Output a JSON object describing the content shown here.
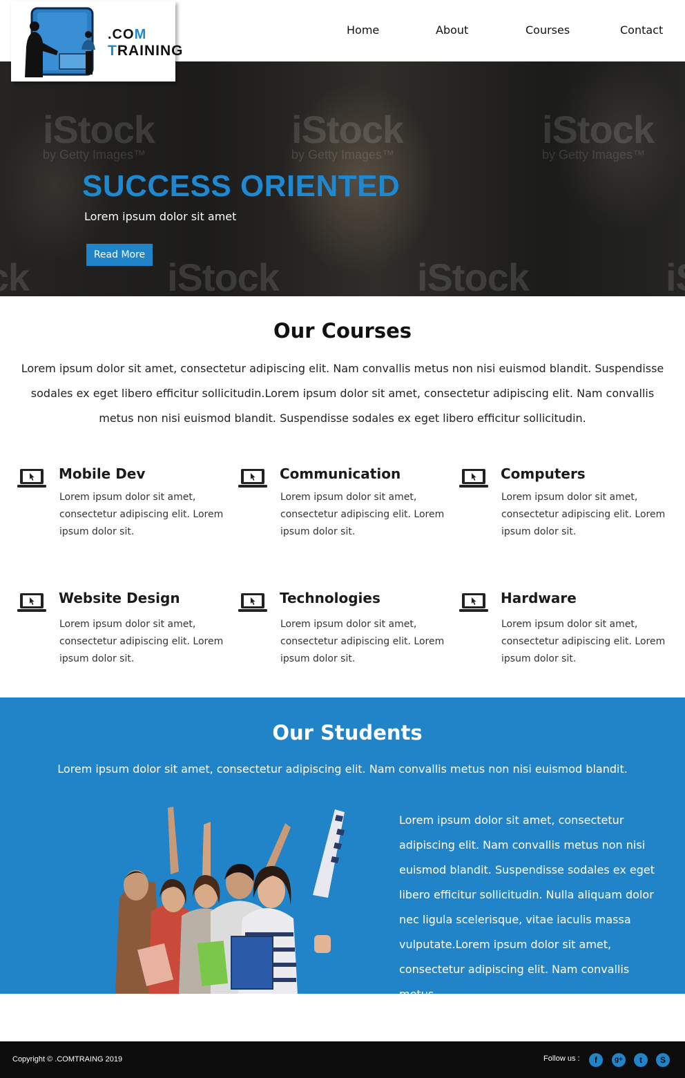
{
  "header": {
    "logo": {
      "line1_prefix": ".CO",
      "line1_accent": "M",
      "line2_accent": "T",
      "line2_rest": "RAINING"
    },
    "nav": [
      "Home",
      "About",
      "Courses",
      "Contact"
    ]
  },
  "hero": {
    "title": "SUCCESS ORIENTED",
    "subtitle": "Lorem ipsum dolor sit amet",
    "button": "Read More",
    "watermark": "iStock",
    "watermark_sub": "by Getty Images™"
  },
  "courses": {
    "title": "Our Courses",
    "intro": "Lorem ipsum dolor sit amet, consectetur adipiscing elit. Nam convallis metus non nisi euismod blandit. Suspendisse sodales ex eget libero efficitur sollicitudin.Lorem ipsum dolor sit amet, consectetur adipiscing elit. Nam convallis metus non nisi euismod blandit. Suspendisse sodales ex eget libero efficitur sollicitudin.",
    "items": [
      {
        "title": "Mobile Dev",
        "desc": "Lorem ipsum dolor sit amet, consectetur adipiscing elit. Lorem ipsum dolor sit.",
        "icon": "laptop-icon"
      },
      {
        "title": "Communication",
        "desc": "Lorem ipsum dolor sit amet, consectetur adipiscing elit. Lorem ipsum dolor sit.",
        "icon": "laptop-icon"
      },
      {
        "title": "Computers",
        "desc": "Lorem ipsum dolor sit amet, consectetur adipiscing elit. Lorem ipsum dolor sit.",
        "icon": "laptop-icon"
      },
      {
        "title": "Website Design",
        "desc": "Lorem ipsum dolor sit amet, consectetur adipiscing elit. Lorem ipsum dolor sit.",
        "icon": "laptop-icon"
      },
      {
        "title": "Technologies",
        "desc": "Lorem ipsum dolor sit amet, consectetur adipiscing elit. Lorem ipsum dolor sit.",
        "icon": "laptop-icon"
      },
      {
        "title": "Hardware",
        "desc": "Lorem ipsum dolor sit amet, consectetur adipiscing elit. Lorem ipsum dolor sit.",
        "icon": "laptop-icon"
      }
    ]
  },
  "students": {
    "title": "Our Students",
    "intro": "Lorem ipsum dolor sit amet, consectetur adipiscing elit. Nam convallis metus non nisi euismod blandit.",
    "body": "Lorem ipsum dolor sit amet, consectetur adipiscing elit. Nam convallis metus non nisi euismod blandit. Suspendisse sodales ex eget libero efficitur sollicitudin. Nulla aliquam dolor nec ligula scelerisque, vitae iaculis massa vulputate.Lorem ipsum dolor sit amet, consectetur adipiscing elit. Nam convallis metus"
  },
  "footer": {
    "copyright": "Copyright © .COMTRAING 2019",
    "follow": "Follow us :",
    "social": [
      {
        "name": "facebook-icon",
        "glyph": "f"
      },
      {
        "name": "google-plus-icon",
        "glyph": "g+"
      },
      {
        "name": "twitter-icon",
        "glyph": "t"
      },
      {
        "name": "skype-icon",
        "glyph": "S"
      }
    ]
  },
  "colors": {
    "accent": "#2184c9",
    "footer_bg": "#0c0c0c"
  }
}
